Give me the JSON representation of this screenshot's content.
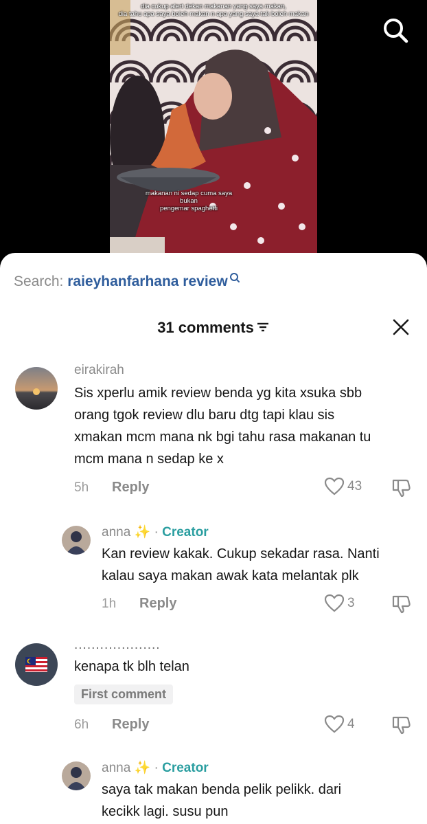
{
  "video": {
    "caption_top": "dia cukup alert dekan makanan yang saya makan,\ndia tahu apa saya boleh makan n apa yang saya tak boleh makan",
    "caption_bottom": "makanan ni sedap cuma saya bukan\npengemar spaghetti",
    "search_icon": "search-icon"
  },
  "search": {
    "prefix": "Search: ",
    "query": "raieyhanfarhana review"
  },
  "header": {
    "title": "31 comments"
  },
  "comments": [
    {
      "username": "eirakirah",
      "text_lines": [
        "Sis xperlu amik review benda yg kita xsuka sbb",
        "orang tgok review dlu baru dtg tapi klau sis",
        "xmakan mcm mana nk bgi tahu rasa makanan tu",
        "mcm mana n sedap ke x"
      ],
      "time": "5h",
      "reply_label": "Reply",
      "likes": "43"
    },
    {
      "username": "anna",
      "sparkle": "✨",
      "separator": "·",
      "creator_label": "Creator",
      "text_lines": [
        "Kan review kakak. Cukup sekadar rasa. Nanti",
        "kalau saya makan awak kata melantak plk"
      ],
      "time": "1h",
      "reply_label": "Reply",
      "likes": "3"
    },
    {
      "username": "....................",
      "text_lines": [
        "kenapa tk blh telan"
      ],
      "badge": "First comment",
      "time": "6h",
      "reply_label": "Reply",
      "likes": "4"
    },
    {
      "username": "anna",
      "sparkle": "✨",
      "separator": "·",
      "creator_label": "Creator",
      "text_lines": [
        "saya tak makan benda pelik pelikk. dari",
        "kecikk lagi. susu pun"
      ]
    }
  ],
  "colors": {
    "link_blue": "#2f5d9c",
    "creator_teal": "#2a9ea0",
    "muted_gray": "#8a8a8a"
  }
}
